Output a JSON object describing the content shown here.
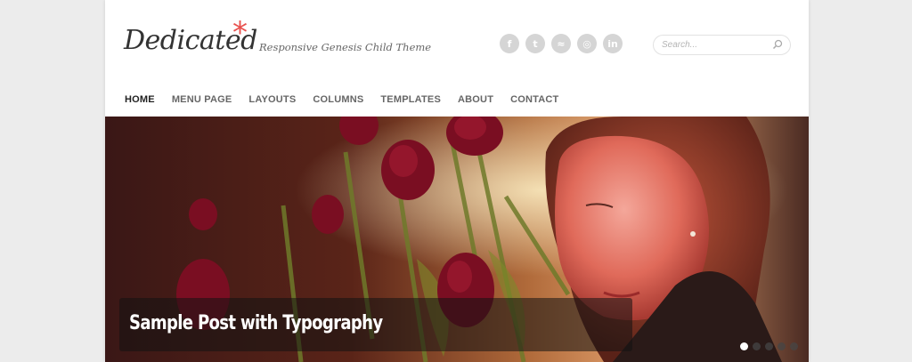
{
  "header": {
    "logo_text": "Dedicated",
    "logo_mark": "*",
    "tagline": "Responsive Genesis Child Theme"
  },
  "social": [
    {
      "icon": "facebook-icon",
      "glyph": "f"
    },
    {
      "icon": "twitter-icon",
      "glyph": "t"
    },
    {
      "icon": "rss-icon",
      "glyph": "≈"
    },
    {
      "icon": "dribbble-icon",
      "glyph": "◎"
    },
    {
      "icon": "linkedin-icon",
      "glyph": "in"
    }
  ],
  "search": {
    "placeholder": "Search..."
  },
  "nav": {
    "items": [
      {
        "label": "HOME",
        "active": true
      },
      {
        "label": "MENU PAGE"
      },
      {
        "label": "LAYOUTS"
      },
      {
        "label": "COLUMNS"
      },
      {
        "label": "TEMPLATES"
      },
      {
        "label": "ABOUT"
      },
      {
        "label": "CONTACT"
      }
    ]
  },
  "slider": {
    "caption": "Sample Post with Typography",
    "slide_count": 5,
    "active_slide": 1
  },
  "colors": {
    "accent": "#e8504d",
    "background": "#ececec",
    "nav_text": "#666666"
  }
}
